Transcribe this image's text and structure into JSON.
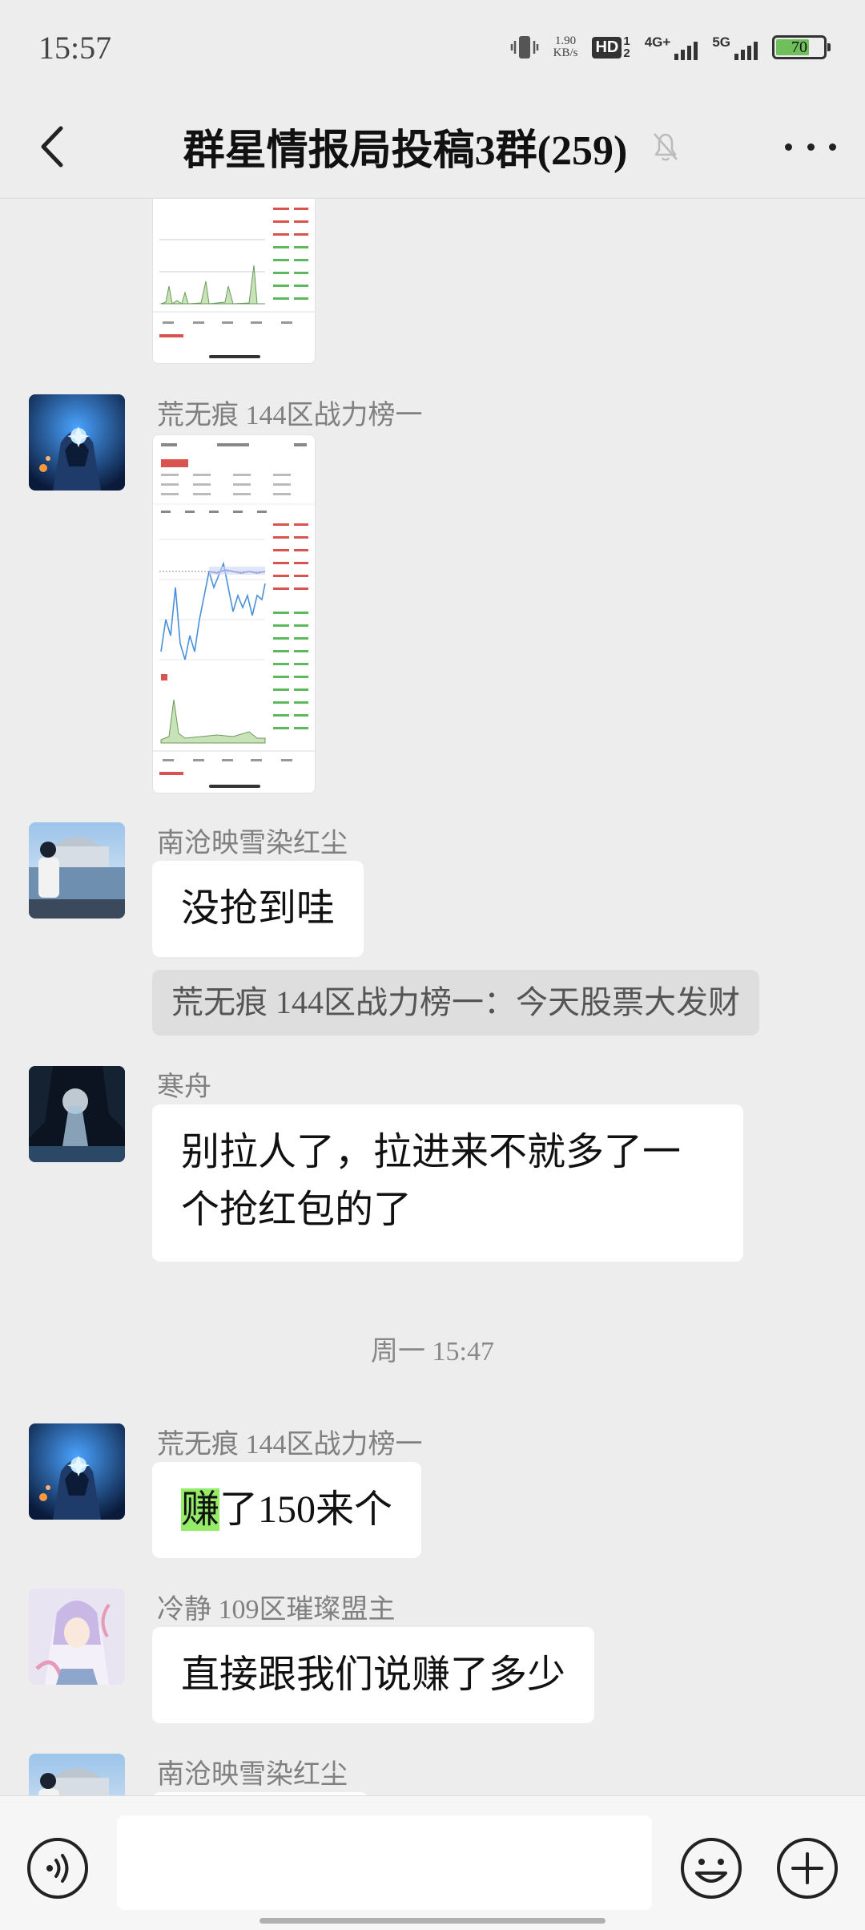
{
  "status_bar": {
    "time": "15:57",
    "net_speed_value": "1.90",
    "net_speed_unit": "KB/s",
    "hd_label": "HD",
    "hd_sub": "1",
    "hd_sub2": "2",
    "signal1_label": "4G+",
    "signal2_label": "5G",
    "battery_level": "70",
    "battery_fraction": 0.7,
    "battery_color": "#6fbf5a"
  },
  "header": {
    "title": "群星情报局投稿3群(259)",
    "back_icon": "chevron-left-icon",
    "mute_icon": "bell-off-icon",
    "more_icon": "more-dots-icon"
  },
  "messages": {
    "m2_sender": "荒无痕 144区战力榜一",
    "m3_sender": "南沧映雪染红尘",
    "m3_text": "没抢到哇",
    "m3_quote": "荒无痕 144区战力榜一：今天股票大发财",
    "m4_sender": "寒舟",
    "m4_line1": "别拉人了，拉进来不就多了一",
    "m4_line2": "个抢红包的了",
    "time_divider": "周一 15:47",
    "m5_sender": "荒无痕 144区战力榜一",
    "m5_highlight": "赚",
    "m5_rest": "了150来个",
    "m6_sender": "冷静 109区璀璨盟主",
    "m6_text": "直接跟我们说赚了多少",
    "m7_sender": "南沧映雪染红尘"
  },
  "input_bar": {
    "voice_icon": "voice-icon",
    "input_value": "",
    "emoji_icon": "emoji-icon",
    "plus_icon": "plus-icon"
  },
  "colors": {
    "background": "#ededed",
    "bubble": "#ffffff",
    "highlight": "#95ec69",
    "sender_text": "#808080"
  }
}
